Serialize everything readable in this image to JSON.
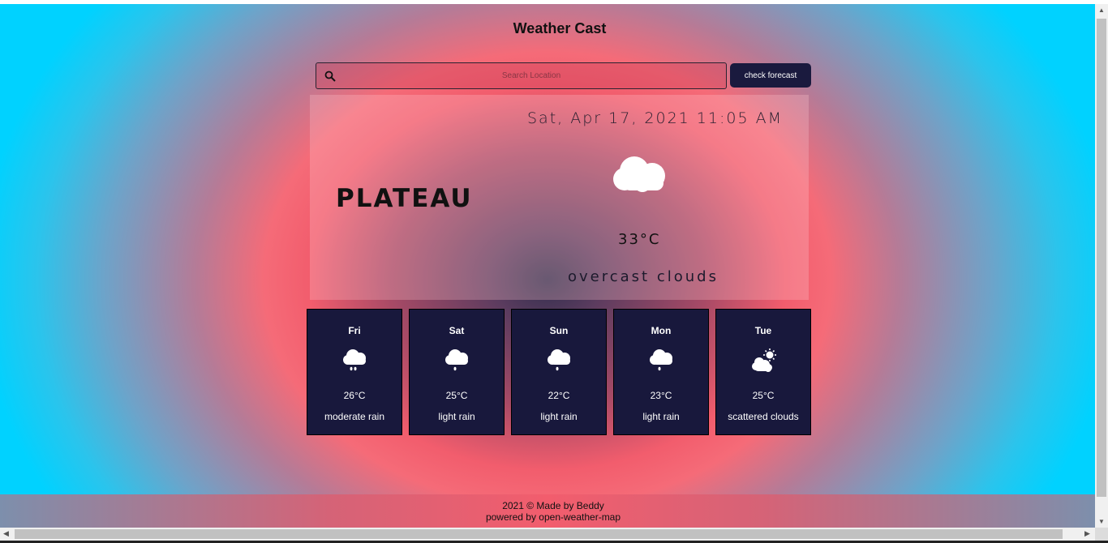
{
  "app": {
    "title": "Weather Cast"
  },
  "search": {
    "placeholder": "Search Location",
    "button_label": "check forecast"
  },
  "current": {
    "city": "PLATEAU",
    "date_time": "Sat, Apr 17, 2021 11:05 AM",
    "icon": "cloud-icon",
    "temperature": "33°C",
    "description": "overcast clouds"
  },
  "forecast": [
    {
      "day": "Fri",
      "icon": "rain-cloud-icon",
      "temp": "26°C",
      "desc": "moderate rain"
    },
    {
      "day": "Sat",
      "icon": "rain-cloud-icon",
      "temp": "25°C",
      "desc": "light rain"
    },
    {
      "day": "Sun",
      "icon": "rain-cloud-icon",
      "temp": "22°C",
      "desc": "light rain"
    },
    {
      "day": "Mon",
      "icon": "rain-cloud-icon",
      "temp": "23°C",
      "desc": "light rain"
    },
    {
      "day": "Tue",
      "icon": "sun-cloud-icon",
      "temp": "25°C",
      "desc": "scattered clouds"
    }
  ],
  "footer": {
    "line1": "2021 © Made by Beddy",
    "line2": "powered by open-weather-map"
  },
  "colors": {
    "card_bg": "#18183c",
    "button_bg": "#1a1a3e",
    "gradient_center": "#2f2e4d",
    "gradient_mid": "#f25d6d",
    "gradient_edge": "#00d2ff"
  }
}
